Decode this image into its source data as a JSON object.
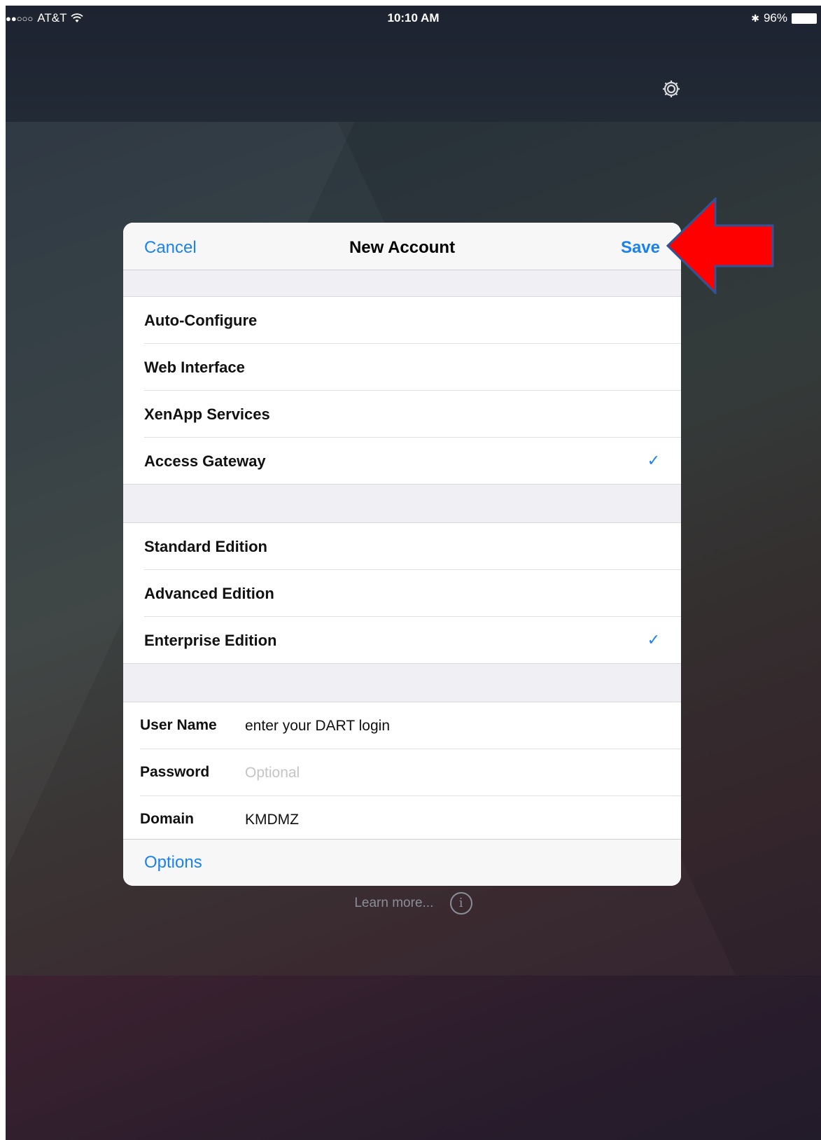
{
  "status_bar": {
    "signal": "●●○○○",
    "carrier": "AT&T",
    "wifi_icon": "wifi-icon",
    "time": "10:10 AM",
    "bluetooth": "✱",
    "battery": "96%"
  },
  "toolbar": {
    "settings_icon": "gear-icon"
  },
  "modal": {
    "cancel": "Cancel",
    "title": "New Account",
    "save": "Save",
    "connection_types": [
      {
        "label": "Auto-Configure",
        "checked": false
      },
      {
        "label": "Web Interface",
        "checked": false
      },
      {
        "label": "XenApp Services",
        "checked": false
      },
      {
        "label": "Access Gateway",
        "checked": true
      }
    ],
    "editions": [
      {
        "label": "Standard Edition",
        "checked": false
      },
      {
        "label": "Advanced Edition",
        "checked": false
      },
      {
        "label": "Enterprise Edition",
        "checked": true
      }
    ],
    "check_glyph": "✓",
    "fields": {
      "user_name": {
        "label": "User Name",
        "value": "enter your DART login",
        "placeholder": ""
      },
      "password": {
        "label": "Password",
        "value": "",
        "placeholder": "Optional"
      },
      "domain": {
        "label": "Domain",
        "value": "KMDMZ",
        "placeholder": ""
      }
    },
    "options": "Options"
  },
  "learn_more": {
    "text": "Learn more...",
    "info_glyph": "i"
  },
  "annotation": {
    "arrow_color": "#ff0000",
    "arrow_outline": "#2f5597"
  },
  "colors": {
    "accent": "#1a82f0"
  }
}
